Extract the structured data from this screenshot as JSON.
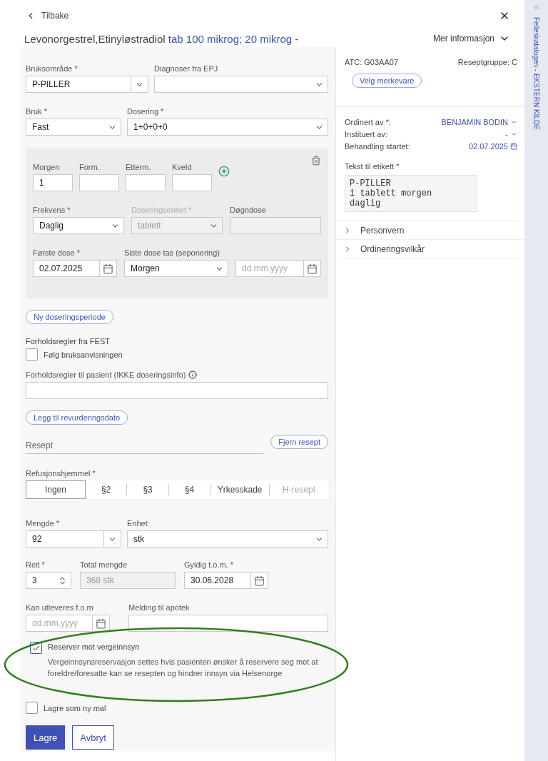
{
  "back": "Tilbake",
  "title": {
    "drug": "Levonorgestrel,Etinyløstradiol",
    "strength": "tab 100 mikrog; 20 mikrog -"
  },
  "more_info": "Mer informasjon",
  "usage_area": {
    "label": "Bruksområde *",
    "value": "P-PILLER"
  },
  "diagnoses": {
    "label": "Diagnoser fra EPJ"
  },
  "use": {
    "label": "Bruk *",
    "value": "Fast"
  },
  "dosing": {
    "label": "Dosering *",
    "value": "1+0+0+0"
  },
  "dose_period": {
    "times": [
      {
        "label": "Morgen",
        "value": "1"
      },
      {
        "label": "Form."
      },
      {
        "label": "Etterm."
      },
      {
        "label": "Kveld"
      }
    ],
    "frequency": {
      "label": "Frekvens *",
      "value": "Daglig"
    },
    "dose_unit": {
      "label": "Doseringsenhet *",
      "value": "tablett",
      "disabled": true
    },
    "daily_dose": {
      "label": "Døgndose",
      "disabled": true
    },
    "first_dose": {
      "label": "Første dose *",
      "value": "02.07.2025"
    },
    "last_dose": {
      "label": "Siste dose tas (seponering)",
      "value": "Morgen"
    },
    "last_dose_date": {
      "placeholder": "dd.mm.yyyy"
    }
  },
  "new_period_button": "Ny doseringsperiode",
  "fest": {
    "label": "Forholdsregler fra FEST",
    "checkbox": {
      "label": "Følg bruksanvisningen",
      "checked": false
    }
  },
  "patient_precautions": {
    "label": "Forholdsregler til pasient (IKKE doseringsinfo)"
  },
  "revision_button": "Legg til revurderingsdato",
  "prescription": {
    "label": "Resept",
    "remove_button": "Fjern resept"
  },
  "refund": {
    "label": "Refusjonshjemmel *",
    "options": [
      {
        "label": "Ingen",
        "selected": true,
        "disabled": false
      },
      {
        "label": "§2",
        "selected": false,
        "disabled": false
      },
      {
        "label": "§3",
        "selected": false,
        "disabled": false
      },
      {
        "label": "§4",
        "selected": false,
        "disabled": false
      },
      {
        "label": "Yrkesskade",
        "selected": false,
        "disabled": false
      },
      {
        "label": "H-resept",
        "selected": false,
        "disabled": true
      }
    ]
  },
  "amount": {
    "label": "Mengde *",
    "value": "92"
  },
  "unit": {
    "label": "Enhet",
    "value": "stk"
  },
  "reit": {
    "label": "Reit *",
    "value": "3"
  },
  "total": {
    "label": "Total mengde",
    "value": "368 stk",
    "disabled": true
  },
  "valid_to": {
    "label": "Gyldig t.o.m. *",
    "value": "30.06.2028"
  },
  "dispense_from": {
    "label": "Kan utleveres f.o.m",
    "placeholder": "dd.mm.yyyy"
  },
  "pharmacy_message": {
    "label": "Melding til apotek"
  },
  "guardian": {
    "label": "Reserver mot vergeinnsyn",
    "checked": true,
    "description": "Vergeinnsynsreservasjon settes hvis pasienten ønsker å reservere seg mot at foreldre/foresatte kan se resepten og hindrer innsyn via Helsenorge"
  },
  "save_template": {
    "label": "Lagre som ny mal",
    "checked": false
  },
  "buttons": [
    {
      "label": "Lagre",
      "kind": "primary"
    },
    {
      "label": "Avbryt",
      "kind": "secondary"
    }
  ],
  "atc": "ATC: G03AA07",
  "prescription_group": "Reseptgruppe: C",
  "brand_button": "Velg merkevare",
  "details": [
    {
      "label": "Ordinert av *:",
      "value": "BENJAMIN BODIN",
      "kind": "menu"
    },
    {
      "label": "Instituert av:",
      "value": "-",
      "kind": "menu"
    },
    {
      "label": "Behandling startet:",
      "value": "02.07.2025",
      "kind": "date"
    }
  ],
  "label_text": {
    "label": "Tekst til etikett *",
    "value": "P-PILLER\n1 tablett morgen\ndaglig"
  },
  "sections": [
    {
      "label": "Personvern",
      "expanded": false
    },
    {
      "label": "Ordineringsvilkår",
      "expanded": false
    }
  ],
  "side_tab": "Felleskatalogen - EKSTERN KILDE"
}
